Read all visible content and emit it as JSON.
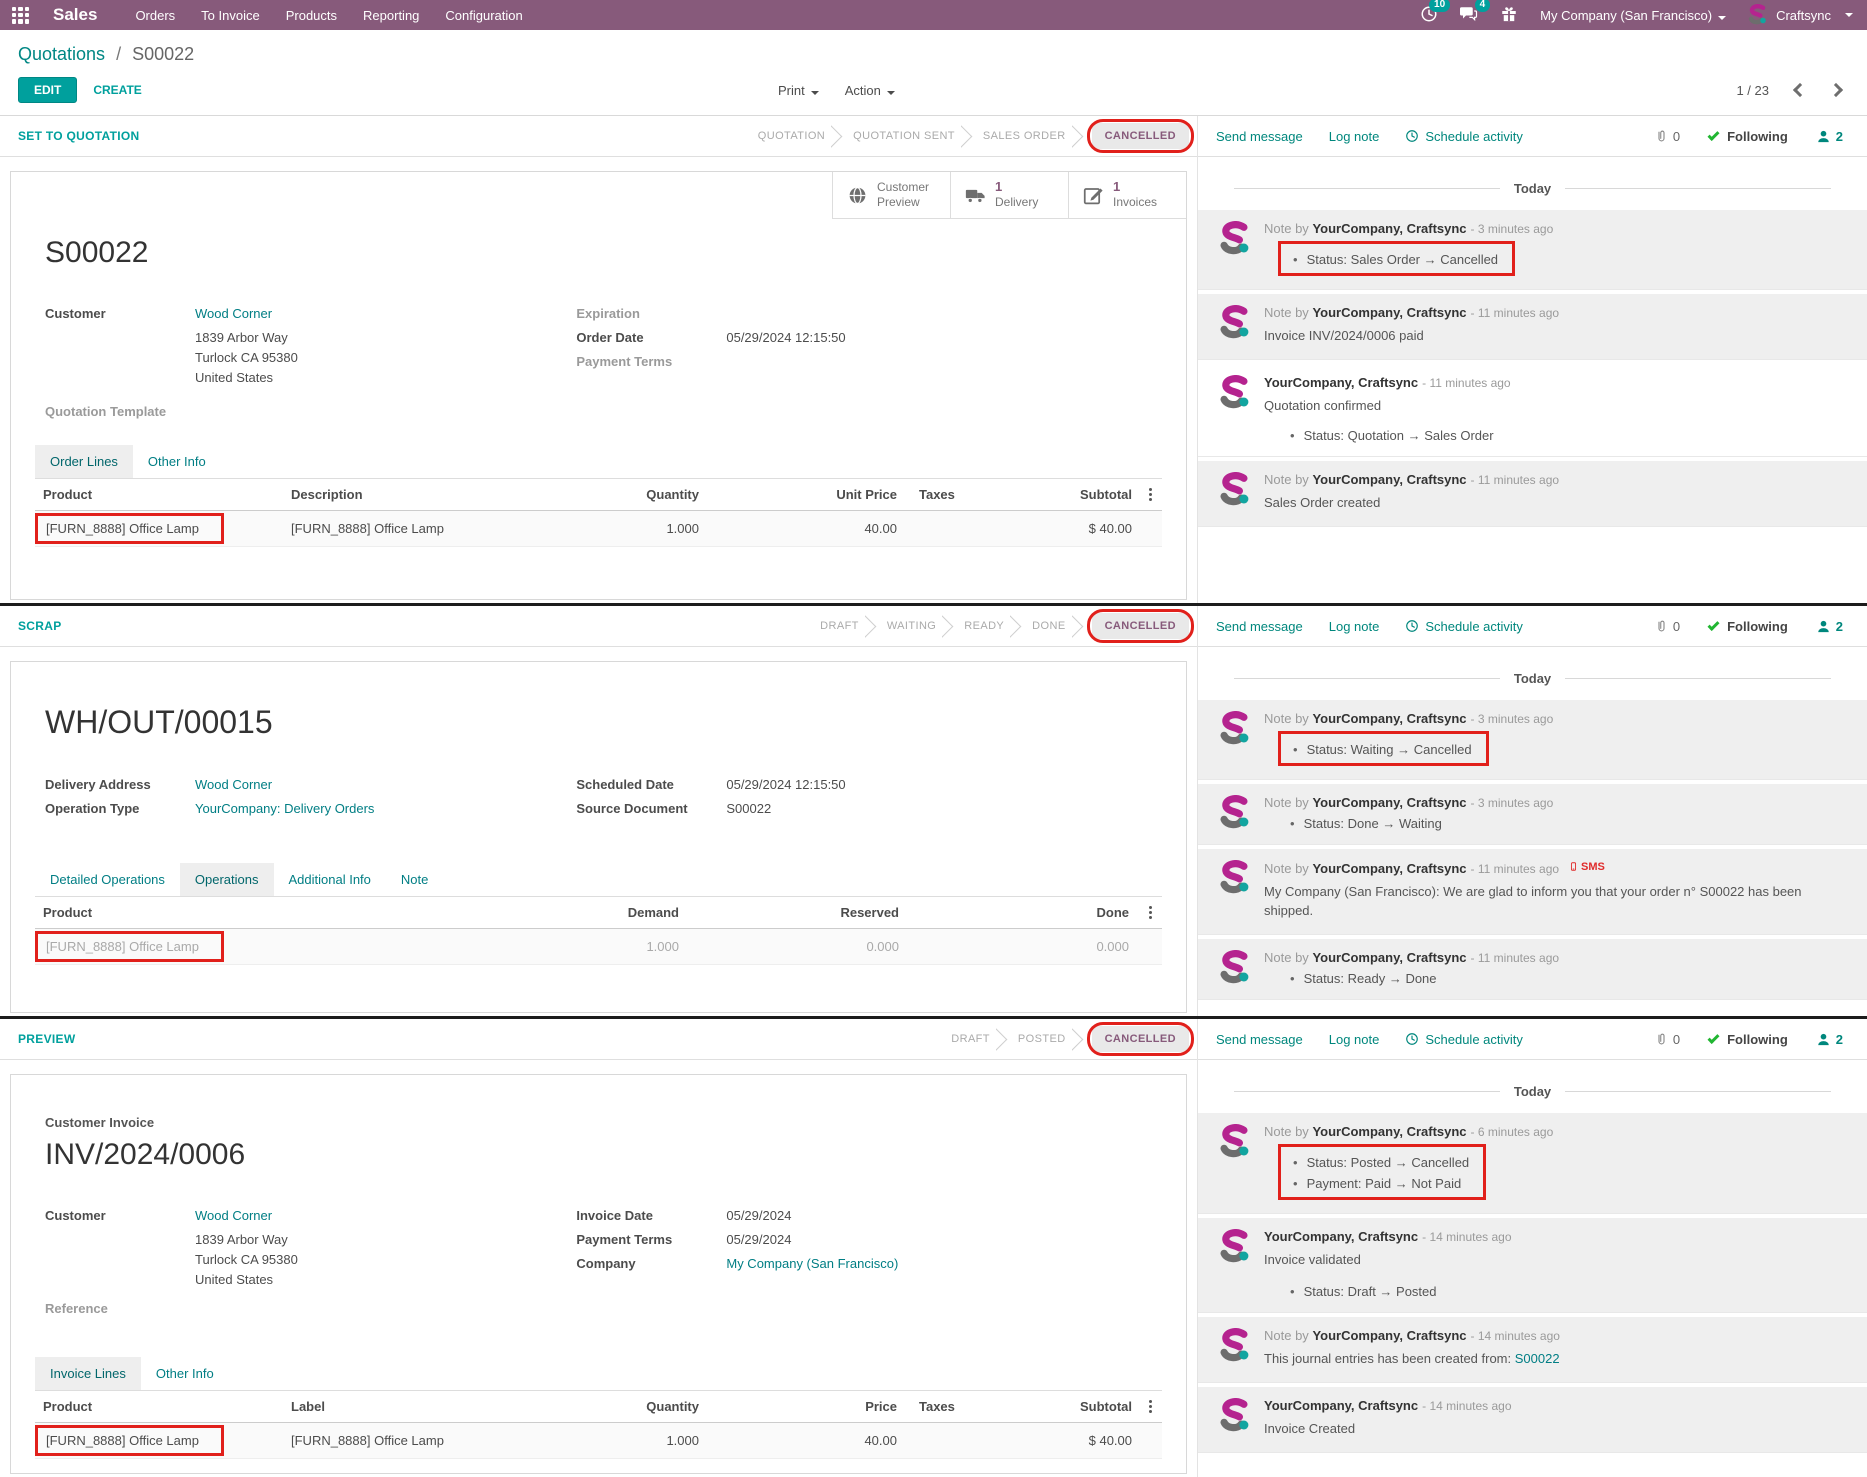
{
  "navbar": {
    "app_name": "Sales",
    "menus": [
      "Orders",
      "To Invoice",
      "Products",
      "Reporting",
      "Configuration"
    ],
    "activity_badge": "10",
    "message_badge": "4",
    "company": "My Company (San Francisco)",
    "user": "Craftsync"
  },
  "header": {
    "breadcrumb_parent": "Quotations",
    "breadcrumb_sep": "/",
    "breadcrumb_current": "S00022",
    "edit": "EDIT",
    "create": "CREATE",
    "print": "Print",
    "action": "Action",
    "pager": "1 / 23"
  },
  "chatter_common": {
    "send": "Send message",
    "log": "Log note",
    "schedule": "Schedule activity",
    "attachments": "0",
    "following": "Following",
    "followers": "2",
    "today": "Today"
  },
  "s1": {
    "action": "SET TO QUOTATION",
    "steps": [
      "QUOTATION",
      "QUOTATION SENT",
      "SALES ORDER",
      "CANCELLED"
    ],
    "buttons": {
      "b1_line1": "Customer",
      "b1_line2": "Preview",
      "b2_count": "1",
      "b2_label": "Delivery",
      "b3_count": "1",
      "b3_label": "Invoices"
    },
    "title": "S00022",
    "f": {
      "customer_label": "Customer",
      "customer": "Wood Corner",
      "addr1": "1839 Arbor Way",
      "addr2": "Turlock CA 95380",
      "addr3": "United States",
      "expiration_label": "Expiration",
      "order_date_label": "Order Date",
      "order_date": "05/29/2024 12:15:50",
      "payment_terms_label": "Payment Terms",
      "quotation_template_label": "Quotation Template"
    },
    "tabs": [
      "Order Lines",
      "Other Info"
    ],
    "th": [
      "Product",
      "Description",
      "Quantity",
      "Unit Price",
      "Taxes",
      "Subtotal"
    ],
    "row": {
      "product": "[FURN_8888] Office Lamp",
      "description": "[FURN_8888] Office Lamp",
      "quantity": "1.000",
      "unit_price": "40.00",
      "subtotal": "$ 40.00"
    },
    "msgs": [
      {
        "prefix": "Note by",
        "author": "YourCompany, Craftsync",
        "time": "- 3 minutes ago",
        "b1": "Status: Sales Order → Cancelled"
      },
      {
        "prefix": "Note by",
        "author": "YourCompany, Craftsync",
        "time": "- 11 minutes ago",
        "body": "Invoice INV/2024/0006 paid"
      },
      {
        "prefix": "",
        "author": "YourCompany, Craftsync",
        "time": "- 11 minutes ago",
        "body": "Quotation confirmed",
        "b1": "Status: Quotation → Sales Order"
      },
      {
        "prefix": "Note by",
        "author": "YourCompany, Craftsync",
        "time": "- 11 minutes ago",
        "body": "Sales Order created"
      }
    ]
  },
  "s2": {
    "action": "SCRAP",
    "steps": [
      "DRAFT",
      "WAITING",
      "READY",
      "DONE",
      "CANCELLED"
    ],
    "title": "WH/OUT/00015",
    "f": {
      "delivery_label": "Delivery Address",
      "delivery": "Wood Corner",
      "optype_label": "Operation Type",
      "optype": "YourCompany: Delivery Orders",
      "sched_label": "Scheduled Date",
      "sched": "05/29/2024 12:15:50",
      "source_label": "Source Document",
      "source": "S00022"
    },
    "tabs": [
      "Detailed Operations",
      "Operations",
      "Additional Info",
      "Note"
    ],
    "th": [
      "Product",
      "Demand",
      "Reserved",
      "Done"
    ],
    "row": {
      "product": "[FURN_8888] Office Lamp",
      "demand": "1.000",
      "reserved": "0.000",
      "done": "0.000"
    },
    "msgs": [
      {
        "prefix": "Note by",
        "author": "YourCompany, Craftsync",
        "time": "- 3 minutes ago",
        "b1": "Status: Waiting → Cancelled"
      },
      {
        "prefix": "Note by",
        "author": "YourCompany, Craftsync",
        "time": "- 3 minutes ago",
        "b1": "Status: Done → Waiting"
      },
      {
        "prefix": "Note by",
        "author": "YourCompany, Craftsync",
        "time": "- 11 minutes ago",
        "sms": "SMS",
        "body": "My Company (San Francisco): We are glad to inform you that your order n° S00022 has been shipped."
      },
      {
        "prefix": "Note by",
        "author": "YourCompany, Craftsync",
        "time": "- 11 minutes ago",
        "b1": "Status: Ready → Done"
      }
    ]
  },
  "s3": {
    "action": "PREVIEW",
    "steps": [
      "DRAFT",
      "POSTED",
      "CANCELLED"
    ],
    "subtitle": "Customer Invoice",
    "title": "INV/2024/0006",
    "f": {
      "customer_label": "Customer",
      "customer": "Wood Corner",
      "addr1": "1839 Arbor Way",
      "addr2": "Turlock CA 95380",
      "addr3": "United States",
      "reference_label": "Reference",
      "invoice_date_label": "Invoice Date",
      "invoice_date": "05/29/2024",
      "payment_terms_label": "Payment Terms",
      "payment_terms": "05/29/2024",
      "company_label": "Company",
      "company": "My Company (San Francisco)"
    },
    "tabs": [
      "Invoice Lines",
      "Other Info"
    ],
    "th": [
      "Product",
      "Label",
      "Quantity",
      "Price",
      "Taxes",
      "Subtotal"
    ],
    "row": {
      "product": "[FURN_8888] Office Lamp",
      "label": "[FURN_8888] Office Lamp",
      "quantity": "1.000",
      "price": "40.00",
      "subtotal": "$ 40.00"
    },
    "msgs": [
      {
        "prefix": "Note by",
        "author": "YourCompany, Craftsync",
        "time": "- 6 minutes ago",
        "b1": "Status: Posted → Cancelled",
        "b2": "Payment: Paid → Not Paid"
      },
      {
        "prefix": "",
        "author": "YourCompany, Craftsync",
        "time": "- 14 minutes ago",
        "body": "Invoice validated",
        "b1": "Status: Draft → Posted"
      },
      {
        "prefix": "Note by",
        "author": "YourCompany, Craftsync",
        "time": "- 14 minutes ago",
        "body": "This journal entries has been created from:",
        "link": "S00022"
      },
      {
        "prefix": "",
        "author": "YourCompany, Craftsync",
        "time": "- 14 minutes ago",
        "body": "Invoice Created"
      }
    ]
  }
}
